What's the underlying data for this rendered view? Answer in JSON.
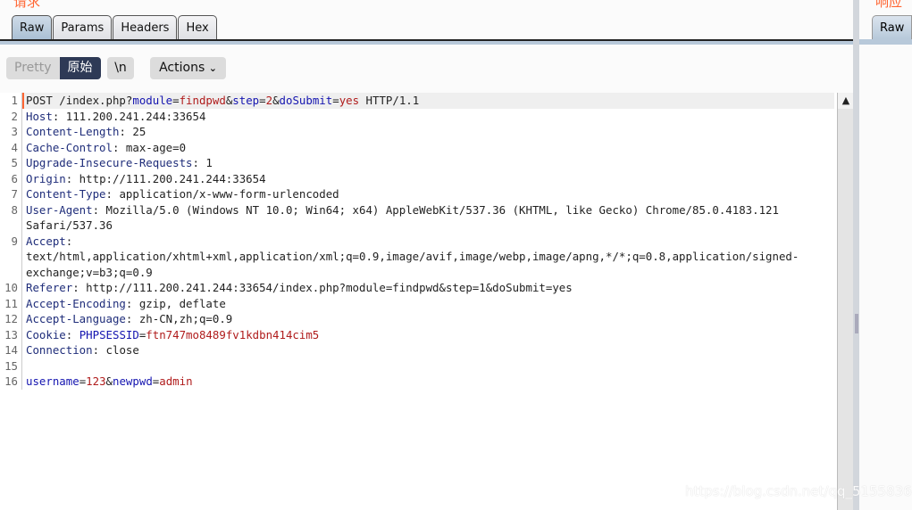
{
  "left_panel": {
    "title": "请求",
    "tabs": [
      {
        "label": "Raw",
        "active": true
      },
      {
        "label": "Params"
      },
      {
        "label": "Headers"
      },
      {
        "label": "Hex"
      }
    ],
    "toolbar": {
      "pretty": "Pretty",
      "raw": "原始",
      "newline": "\\n",
      "actions": "Actions"
    }
  },
  "right_panel": {
    "title": "响应",
    "tabs": [
      {
        "label": "Raw"
      }
    ]
  },
  "editor": {
    "lines": [
      [
        {
          "t": "POST /index.php?",
          "c": "v"
        },
        {
          "t": "module",
          "c": "k"
        },
        {
          "t": "=",
          "c": "v"
        },
        {
          "t": "findpwd",
          "c": "p"
        },
        {
          "t": "&",
          "c": "v"
        },
        {
          "t": "step",
          "c": "k"
        },
        {
          "t": "=",
          "c": "v"
        },
        {
          "t": "2",
          "c": "p"
        },
        {
          "t": "&",
          "c": "v"
        },
        {
          "t": "doSubmit",
          "c": "k"
        },
        {
          "t": "=",
          "c": "v"
        },
        {
          "t": "yes",
          "c": "p"
        },
        {
          "t": " HTTP/1.1",
          "c": "v"
        }
      ],
      [
        {
          "t": "Host",
          "c": "h"
        },
        {
          "t": ": 111.200.241.244:33654",
          "c": "v"
        }
      ],
      [
        {
          "t": "Content-Length",
          "c": "h"
        },
        {
          "t": ": 25",
          "c": "v"
        }
      ],
      [
        {
          "t": "Cache-Control",
          "c": "h"
        },
        {
          "t": ": max-age=0",
          "c": "v"
        }
      ],
      [
        {
          "t": "Upgrade-Insecure-Requests",
          "c": "h"
        },
        {
          "t": ": 1",
          "c": "v"
        }
      ],
      [
        {
          "t": "Origin",
          "c": "h"
        },
        {
          "t": ": http://111.200.241.244:33654",
          "c": "v"
        }
      ],
      [
        {
          "t": "Content-Type",
          "c": "h"
        },
        {
          "t": ": application/x-www-form-urlencoded",
          "c": "v"
        }
      ],
      [
        {
          "t": "User-Agent",
          "c": "h"
        },
        {
          "t": ": Mozilla/5.0 (Windows NT 10.0; Win64; x64) AppleWebKit/537.36 (KHTML, like Gecko) Chrome/85.0.4183.121 Safari/537.36",
          "c": "v"
        }
      ],
      [
        {
          "t": "Accept",
          "c": "h"
        },
        {
          "t": ": text/html,application/xhtml+xml,application/xml;q=0.9,image/avif,image/webp,image/apng,*/*;q=0.8,application/signed-exchange;v=b3;q=0.9",
          "c": "v"
        }
      ],
      [
        {
          "t": "Referer",
          "c": "h"
        },
        {
          "t": ": http://111.200.241.244:33654/index.php?module=findpwd&step=1&doSubmit=yes",
          "c": "v"
        }
      ],
      [
        {
          "t": "Accept-Encoding",
          "c": "h"
        },
        {
          "t": ": gzip, deflate",
          "c": "v"
        }
      ],
      [
        {
          "t": "Accept-Language",
          "c": "h"
        },
        {
          "t": ": zh-CN,zh;q=0.9",
          "c": "v"
        }
      ],
      [
        {
          "t": "Cookie",
          "c": "h"
        },
        {
          "t": ": ",
          "c": "v"
        },
        {
          "t": "PHPSESSID",
          "c": "k"
        },
        {
          "t": "=",
          "c": "v"
        },
        {
          "t": "ftn747mo8489fv1kdbn414cim5",
          "c": "p"
        }
      ],
      [
        {
          "t": "Connection",
          "c": "h"
        },
        {
          "t": ": close",
          "c": "v"
        }
      ],
      [],
      [
        {
          "t": "username",
          "c": "k"
        },
        {
          "t": "=",
          "c": "v"
        },
        {
          "t": "123",
          "c": "p"
        },
        {
          "t": "&",
          "c": "v"
        },
        {
          "t": "newpwd",
          "c": "k"
        },
        {
          "t": "=",
          "c": "v"
        },
        {
          "t": "admin",
          "c": "p"
        }
      ]
    ]
  },
  "watermark": "https://blog.csdn.net/qq_51558360"
}
